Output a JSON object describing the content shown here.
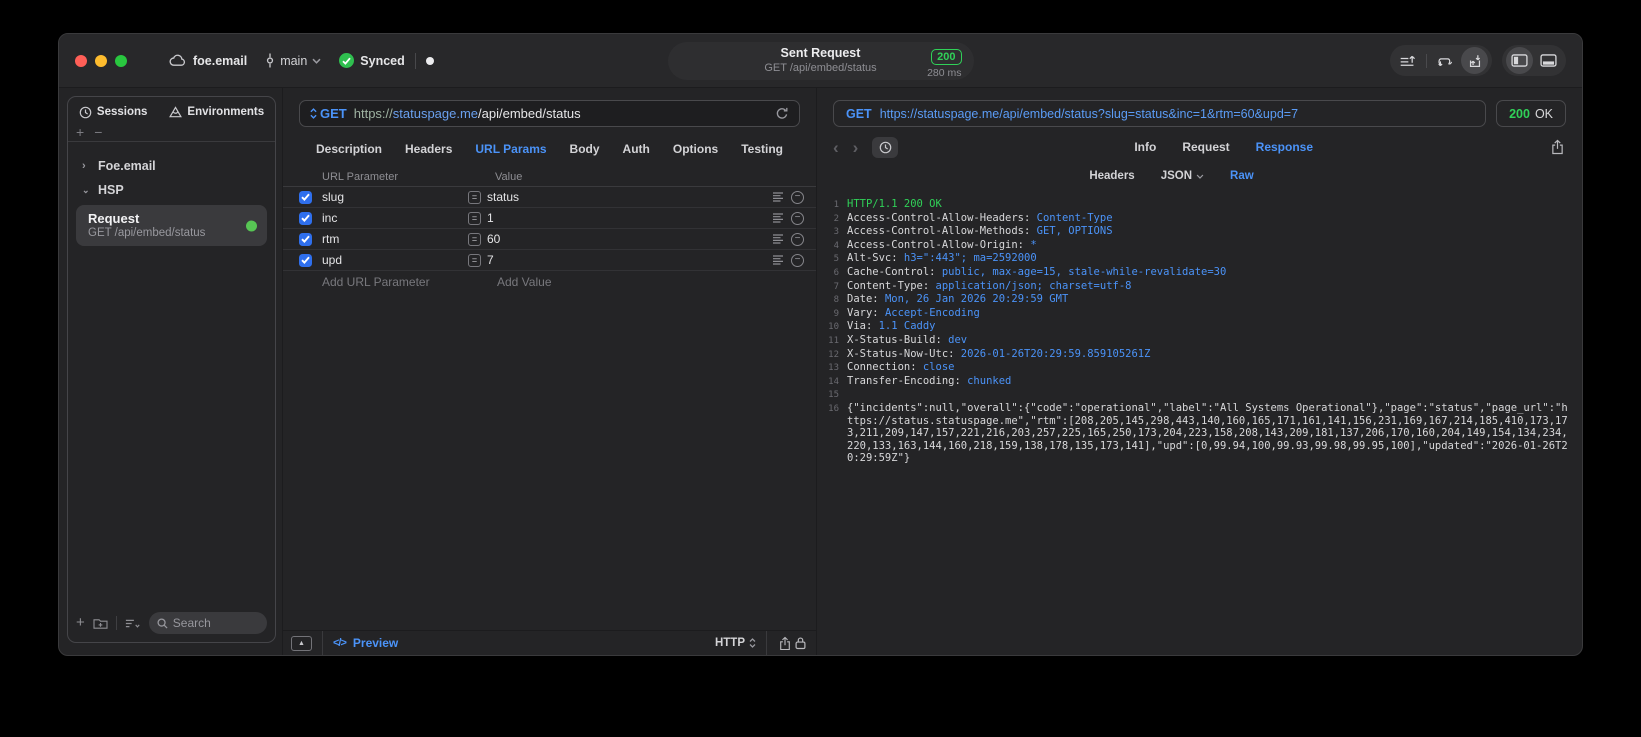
{
  "titlebar": {
    "project_name": "foe.email",
    "branch_name": "main",
    "sync_label": "Synced",
    "request_summary": {
      "title": "Sent Request",
      "subtitle": "GET /api/embed/status",
      "status_code": "200",
      "duration": "280 ms"
    }
  },
  "sidebar": {
    "tabs": [
      {
        "label": "Sessions"
      },
      {
        "label": "Environments"
      }
    ],
    "groups": [
      {
        "label": "Foe.email"
      },
      {
        "label": "HSP"
      }
    ],
    "request_item": {
      "title": "Request",
      "subtitle": "GET /api/embed/status"
    },
    "search_placeholder": "Search"
  },
  "request_editor": {
    "method": "GET",
    "url": {
      "scheme": "https://",
      "host": "statuspage.me",
      "path": "/api/embed/status"
    },
    "tabs": [
      "Description",
      "Headers",
      "URL Params",
      "Body",
      "Auth",
      "Options",
      "Testing"
    ],
    "active_tab": "URL Params",
    "params": {
      "columns": [
        "URL Parameter",
        "Value"
      ],
      "rows": [
        {
          "name": "slug",
          "value": "status",
          "enabled": true
        },
        {
          "name": "inc",
          "value": "1",
          "enabled": true
        },
        {
          "name": "rtm",
          "value": "60",
          "enabled": true
        },
        {
          "name": "upd",
          "value": "7",
          "enabled": true
        }
      ],
      "add_row": {
        "name_placeholder": "Add URL Parameter",
        "value_placeholder": "Add Value"
      }
    },
    "footer": {
      "preview_label": "Preview",
      "protocol": "HTTP"
    }
  },
  "response_viewer": {
    "method": "GET",
    "url": "https://statuspage.me/api/embed/status?slug=status&inc=1&rtm=60&upd=7",
    "status_code": "200",
    "status_text": "OK",
    "tabs": [
      "Info",
      "Request",
      "Response"
    ],
    "active_tab": "Response",
    "subtabs": [
      "Headers",
      "JSON",
      "Raw"
    ],
    "active_subtab": "Raw",
    "raw": {
      "status_line": "HTTP/1.1 200 OK",
      "headers": [
        {
          "name": "Access-Control-Allow-Headers",
          "value": "Content-Type"
        },
        {
          "name": "Access-Control-Allow-Methods",
          "value": "GET, OPTIONS"
        },
        {
          "name": "Access-Control-Allow-Origin",
          "value": "*"
        },
        {
          "name": "Alt-Svc",
          "value": "h3=\":443\"; ma=2592000"
        },
        {
          "name": "Cache-Control",
          "value": "public, max-age=15, stale-while-revalidate=30"
        },
        {
          "name": "Content-Type",
          "value": "application/json; charset=utf-8"
        },
        {
          "name": "Date",
          "value": "Mon, 26 Jan 2026 20:29:59 GMT"
        },
        {
          "name": "Vary",
          "value": "Accept-Encoding"
        },
        {
          "name": "Via",
          "value": "1.1 Caddy"
        },
        {
          "name": "X-Status-Build",
          "value": "dev"
        },
        {
          "name": "X-Status-Now-Utc",
          "value": "2026-01-26T20:29:59.859105261Z"
        },
        {
          "name": "Connection",
          "value": "close"
        },
        {
          "name": "Transfer-Encoding",
          "value": "chunked"
        }
      ],
      "body": "{\"incidents\":null,\"overall\":{\"code\":\"operational\",\"label\":\"All Systems Operational\"},\"page\":\"status\",\"page_url\":\"https://status.statuspage.me\",\"rtm\":[208,205,145,298,443,140,160,165,171,161,141,156,231,169,167,214,185,410,173,173,211,209,147,157,221,216,203,257,225,165,250,173,204,223,158,208,143,209,181,137,206,170,160,204,149,154,134,234,220,133,163,144,160,218,159,138,178,135,173,141],\"upd\":[0,99.94,100,99.93,99.98,99.95,100],\"updated\":\"2026-01-26T20:29:59Z\"}"
    }
  },
  "colors": {
    "accent_blue": "#4b93f8",
    "status_green": "#30d158"
  }
}
